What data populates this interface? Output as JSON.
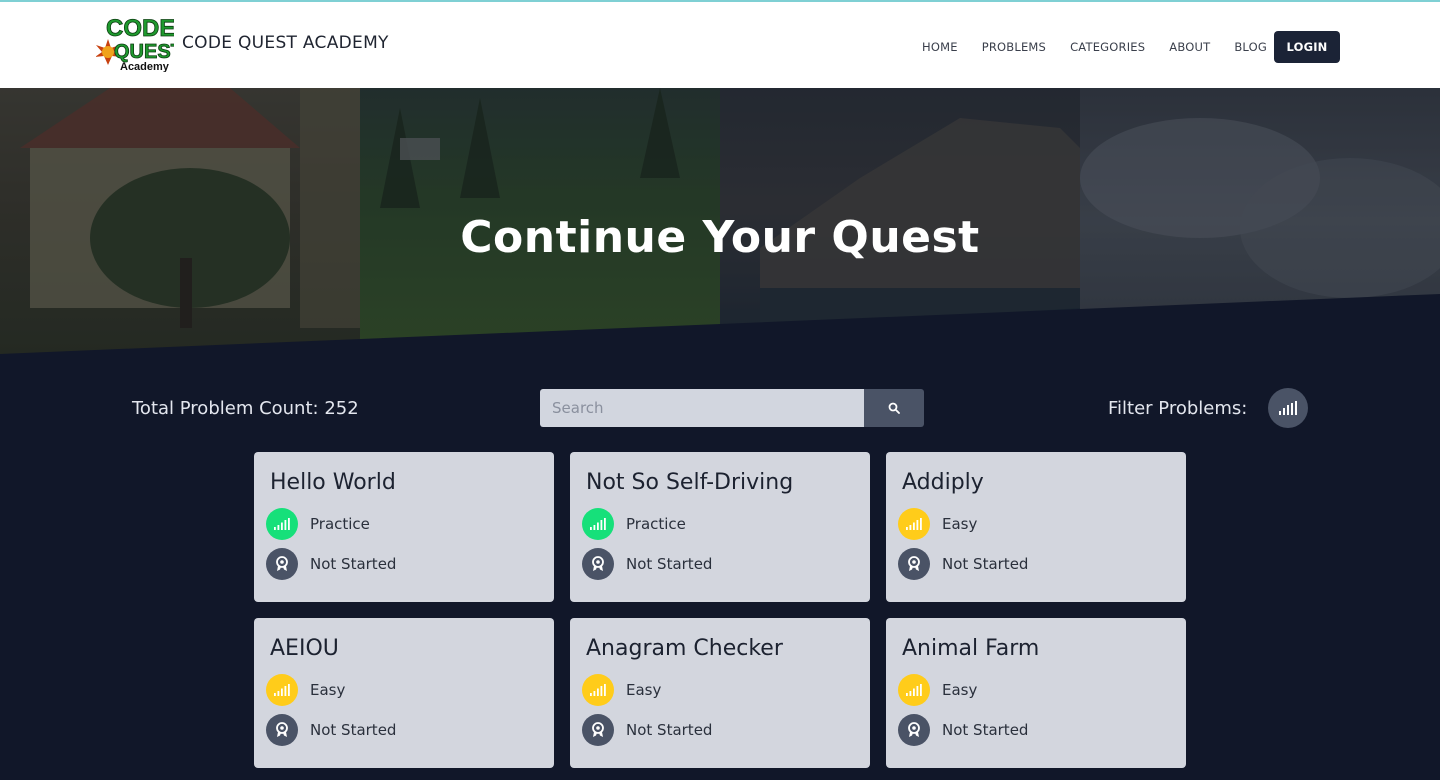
{
  "header": {
    "brand": "CODE QUEST ACADEMY",
    "logo": {
      "line1": "CODE",
      "line2": "QUEST",
      "line3": "Academy"
    },
    "nav": [
      "HOME",
      "PROBLEMS",
      "CATEGORIES",
      "ABOUT",
      "BLOG"
    ],
    "login": "LOGIN"
  },
  "hero": {
    "title": "Continue Your Quest"
  },
  "controls": {
    "count_label": "Total Problem Count: 252",
    "search_placeholder": "Search",
    "filter_label": "Filter Problems:"
  },
  "colors": {
    "practice": "#16e07a",
    "easy": "#ffcc1a",
    "status": "#4a5366"
  },
  "problems": [
    {
      "title": "Hello World",
      "difficulty": "Practice",
      "status": "Not Started"
    },
    {
      "title": "Not So Self-Driving",
      "difficulty": "Practice",
      "status": "Not Started"
    },
    {
      "title": "Addiply",
      "difficulty": "Easy",
      "status": "Not Started"
    },
    {
      "title": "AEIOU",
      "difficulty": "Easy",
      "status": "Not Started"
    },
    {
      "title": "Anagram Checker",
      "difficulty": "Easy",
      "status": "Not Started"
    },
    {
      "title": "Animal Farm",
      "difficulty": "Easy",
      "status": "Not Started"
    }
  ]
}
